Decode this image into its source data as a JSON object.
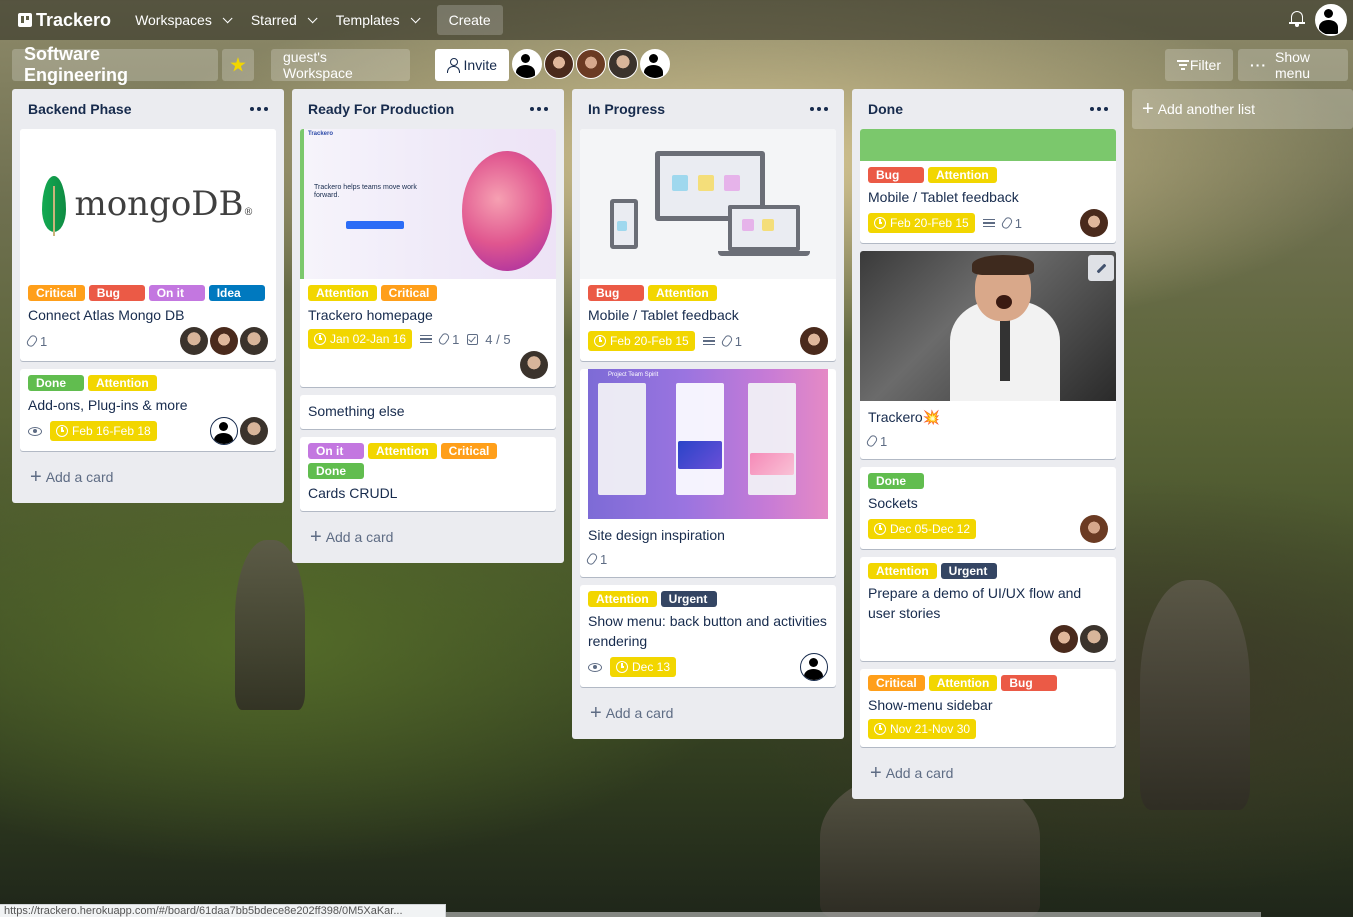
{
  "nav": {
    "logo": "Trackero",
    "items": [
      "Workspaces",
      "Starred",
      "Templates"
    ],
    "create": "Create"
  },
  "board": {
    "title": "Software Engineering",
    "workspace": "guest's Workspace",
    "invite": "Invite",
    "filter": "Filter",
    "show_menu": "Show menu",
    "add_list": "Add another list"
  },
  "label_colors": {
    "Critical": "#ff9f1a",
    "Bug": "#eb5a46",
    "On it": "#c377e0",
    "Idea": "#0079bf",
    "Done": "#61bd4f",
    "Attention": "#f2d600",
    "Urgent": "#344563"
  },
  "add_card": "Add a card",
  "lists": [
    {
      "title": "Backend Phase",
      "cards": [
        {
          "title": "Connect Atlas Mongo DB",
          "labels": [
            "Critical",
            "Bug",
            "On it",
            "Idea"
          ],
          "attachments": "1"
        },
        {
          "title": "Add-ons, Plug-ins & more",
          "labels": [
            "Done",
            "Attention"
          ],
          "date": "Feb 16-Feb 18"
        }
      ]
    },
    {
      "title": "Ready For Production",
      "cards": [
        {
          "title": "Trackero homepage",
          "labels": [
            "Attention",
            "Critical"
          ],
          "date": "Jan 02-Jan 16",
          "attachments": "1",
          "checklist": "4 / 5"
        },
        {
          "title": "Something else"
        },
        {
          "title": "Cards CRUDL",
          "labels": [
            "On it",
            "Attention",
            "Critical",
            "Done"
          ]
        }
      ]
    },
    {
      "title": "In Progress",
      "cards": [
        {
          "title": "Mobile / Tablet feedback",
          "labels": [
            "Bug",
            "Attention"
          ],
          "date": "Feb 20-Feb 15",
          "attachments": "1"
        },
        {
          "title": "Site design inspiration",
          "attachments": "1"
        },
        {
          "title": "Show menu: back button and activities rendering",
          "labels": [
            "Attention",
            "Urgent"
          ],
          "date": "Dec 13"
        }
      ]
    },
    {
      "title": "Done",
      "cards": [
        {
          "title": "Mobile / Tablet feedback",
          "labels": [
            "Bug",
            "Attention"
          ],
          "date": "Feb 20-Feb 15",
          "attachments": "1"
        },
        {
          "title": "Trackero💥",
          "attachments": "1"
        },
        {
          "title": "Sockets",
          "labels": [
            "Done"
          ],
          "date": "Dec 05-Dec 12"
        },
        {
          "title": "Prepare a demo of UI/UX flow and user stories",
          "labels": [
            "Attention",
            "Urgent"
          ]
        },
        {
          "title": "Show-menu sidebar",
          "labels": [
            "Critical",
            "Attention",
            "Bug"
          ],
          "date": "Nov 21-Nov 30"
        }
      ]
    }
  ],
  "covers": {
    "mongo_text": "mongoDB",
    "mongo_reg": "®",
    "trackero_header": "Trackero",
    "trackero_tagline": "Trackero helps teams move work forward.",
    "site_header": "Project Team Spirit"
  },
  "status_url": "https://trackero.herokuapp.com/#/board/61daa7bb5bdece8e202ff398/0M5XaKar..."
}
